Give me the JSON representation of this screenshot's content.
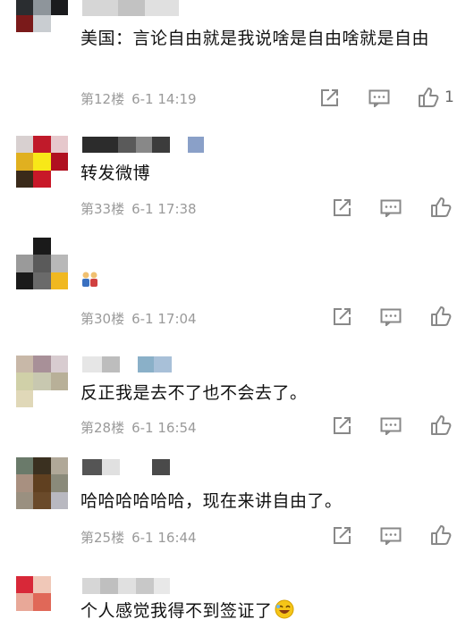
{
  "comments": [
    {
      "text": "美国：言论自由就是我说啥是自由啥就是自由",
      "floor": "第12楼",
      "time": "6-1 14:19",
      "likes": "1"
    },
    {
      "text": "转发微博",
      "floor": "第33楼",
      "time": "6-1 17:38",
      "likes": ""
    },
    {
      "text": "",
      "floor": "第30楼",
      "time": "6-1 17:04",
      "likes": "",
      "emoji": "people-emoji"
    },
    {
      "text": "反正我是去不了也不会去了。",
      "floor": "第28楼",
      "time": "6-1 16:54",
      "likes": ""
    },
    {
      "text": "哈哈哈哈哈哈，现在来讲自由了。",
      "floor": "第25楼",
      "time": "6-1 16:44",
      "likes": ""
    },
    {
      "text": "个人感觉我得不到签证了",
      "floor": "",
      "time": "",
      "likes": "",
      "emoji": "laugh-emoji"
    }
  ],
  "colors": {
    "meta": "#9a9a9a",
    "text": "#111111",
    "icon": "#888888"
  }
}
